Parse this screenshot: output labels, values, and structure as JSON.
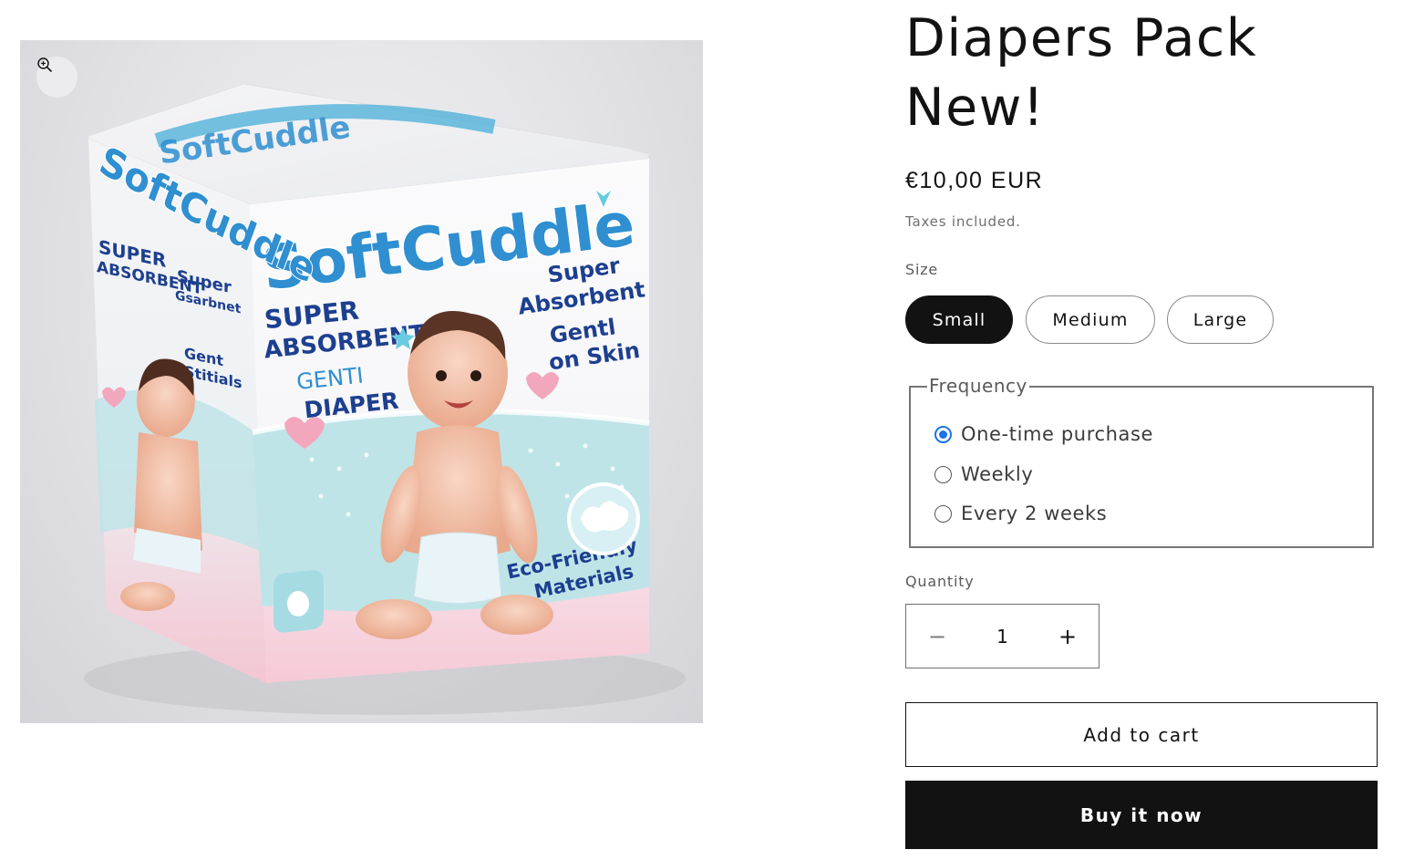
{
  "product": {
    "title_line1": "Diapers Pack",
    "title_line2": "New!",
    "price": "€10,00 EUR",
    "tax_note": "Taxes included."
  },
  "media": {
    "zoom_icon": "zoom-in-icon",
    "box": {
      "brand": "SoftCuddle",
      "front_text_1": "SUPER",
      "front_text_2": "ABSORBENT",
      "front_text_3": "GENTI",
      "front_text_4": "DIAPER",
      "right_text_1": "Super",
      "right_text_2": "Absorbent",
      "right_text_3": "Gentl",
      "right_text_4": "on Skin",
      "right_text_5": "Eco-Friendly",
      "right_text_6": "Materials",
      "left_text_1": "SUPER",
      "left_text_2": "ABSORBENT",
      "left_text_3": "Super",
      "left_text_4": "Gsarbnet",
      "left_text_5": "Gent",
      "left_text_6": "Stitials"
    }
  },
  "size": {
    "label": "Size",
    "options": [
      "Small",
      "Medium",
      "Large"
    ],
    "selected": "Small"
  },
  "frequency": {
    "legend": "Frequency",
    "options": [
      "One-time purchase",
      "Weekly",
      "Every 2 weeks"
    ],
    "selected": "One-time purchase"
  },
  "quantity": {
    "label": "Quantity",
    "value": "1",
    "minus": "−",
    "plus": "+"
  },
  "actions": {
    "add_to_cart": "Add to cart",
    "buy_now": "Buy it now"
  },
  "colors": {
    "primary": "#121212",
    "radio_accent": "#1a73e8",
    "box_pink": "#f6c9d6",
    "box_teal": "#b9e3e8",
    "brand_blue": "#2b7fc4"
  }
}
